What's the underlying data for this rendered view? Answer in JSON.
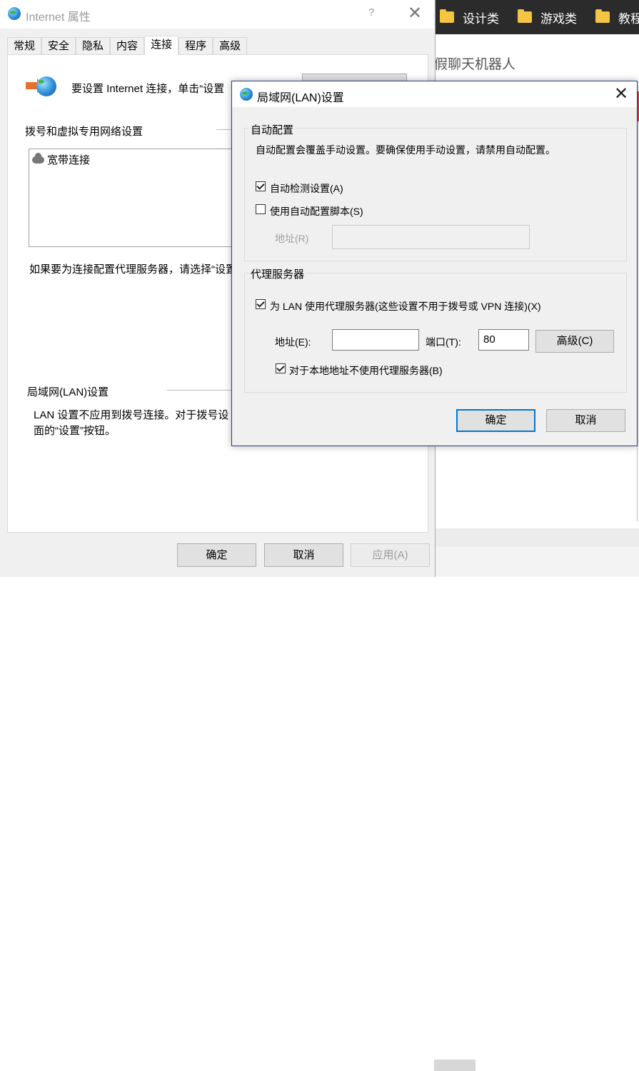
{
  "browser": {
    "bookmarks": [
      "设计类",
      "游戏类",
      "教程"
    ],
    "page_title": "假聊天机器人"
  },
  "props": {
    "title": "Internet 属性",
    "help": "?",
    "close": "✕",
    "tabs": [
      "常规",
      "安全",
      "隐私",
      "内容",
      "连接",
      "程序",
      "高级"
    ],
    "setup_text": "要设置 Internet 连接，单击“设置",
    "dialup_label": "拨号和虚拟专用网络设置",
    "connection_item": "宽带连接",
    "proxy_hint": "如果要为连接配置代理服务器，请选择“设置",
    "lan_label": "局域网(LAN)设置",
    "lan_hint_line1": "LAN 设置不应用到拨号连接。对于拨号设",
    "lan_hint_line2": "面的“设置”按钮。",
    "ok": "确定",
    "cancel": "取消",
    "apply": "应用(A)"
  },
  "lan_dialog": {
    "title": "局域网(LAN)设置",
    "close": "✕",
    "auto_group_title": "自动配置",
    "auto_desc": "自动配置会覆盖手动设置。要确保使用手动设置，请禁用自动配置。",
    "auto_detect_label": "自动检测设置(A)",
    "auto_detect_checked": true,
    "auto_script_label": "使用自动配置脚本(S)",
    "auto_script_checked": false,
    "script_address_label": "地址(R)",
    "script_address_value": "",
    "proxy_group_title": "代理服务器",
    "use_proxy_label": "为 LAN 使用代理服务器(这些设置不用于拨号或 VPN 连接)(X)",
    "use_proxy_checked": true,
    "address_label": "地址(E):",
    "address_value": "",
    "port_label": "端口(T):",
    "port_value": "80",
    "advanced_button": "高级(C)",
    "bypass_local_label": "对于本地地址不使用代理服务器(B)",
    "bypass_local_checked": true,
    "ok": "确定",
    "cancel": "取消"
  }
}
